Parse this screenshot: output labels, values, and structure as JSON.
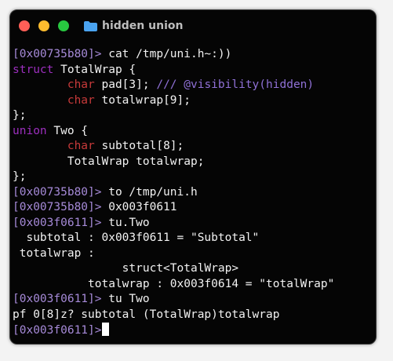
{
  "window": {
    "title": "hidden union",
    "colors": {
      "close": "#ff5f57",
      "minimize": "#febc2e",
      "maximize": "#28c840",
      "folder": "#4aa3f0"
    }
  },
  "terminal": {
    "colors": {
      "text": "#f2f2f2",
      "prompt": "#a68ad8",
      "keyword": "#9d2fbf",
      "type": "#c83a3a",
      "comment": "#8f70d6"
    },
    "lines": [
      [
        {
          "t": "[0x00735b80]> ",
          "c": "prompt"
        },
        {
          "t": "cat /tmp/uni.h~:))",
          "c": "text"
        }
      ],
      [
        {
          "t": "struct",
          "c": "keyword"
        },
        {
          "t": " TotalWrap {",
          "c": "text"
        }
      ],
      [
        {
          "t": "        ",
          "c": "text"
        },
        {
          "t": "char",
          "c": "type"
        },
        {
          "t": " pad[3]; ",
          "c": "text"
        },
        {
          "t": "/// @visibility(hidden)",
          "c": "comment"
        }
      ],
      [
        {
          "t": "        ",
          "c": "text"
        },
        {
          "t": "char",
          "c": "type"
        },
        {
          "t": " totalwrap[9];",
          "c": "text"
        }
      ],
      [
        {
          "t": "};",
          "c": "text"
        }
      ],
      [
        {
          "t": "union",
          "c": "keyword"
        },
        {
          "t": " Two {",
          "c": "text"
        }
      ],
      [
        {
          "t": "        ",
          "c": "text"
        },
        {
          "t": "char",
          "c": "type"
        },
        {
          "t": " subtotal[8];",
          "c": "text"
        }
      ],
      [
        {
          "t": "        TotalWrap totalwrap;",
          "c": "text"
        }
      ],
      [
        {
          "t": "};",
          "c": "text"
        }
      ],
      [
        {
          "t": "[0x00735b80]> ",
          "c": "prompt"
        },
        {
          "t": "to /tmp/uni.h",
          "c": "text"
        }
      ],
      [
        {
          "t": "[0x00735b80]> ",
          "c": "prompt"
        },
        {
          "t": "0x003f0611",
          "c": "text"
        }
      ],
      [
        {
          "t": "[0x003f0611]> ",
          "c": "prompt"
        },
        {
          "t": "tu.Two",
          "c": "text"
        }
      ],
      [
        {
          "t": "  subtotal : 0x003f0611 = \"Subtotal\"",
          "c": "text"
        }
      ],
      [
        {
          "t": " totalwrap :",
          "c": "text"
        }
      ],
      [
        {
          "t": "                struct<TotalWrap>",
          "c": "text"
        }
      ],
      [
        {
          "t": "           totalwrap : 0x003f0614 = \"totalWrap\"",
          "c": "text"
        }
      ],
      [
        {
          "t": "[0x003f0611]> ",
          "c": "prompt"
        },
        {
          "t": "tu Two",
          "c": "text"
        }
      ],
      [
        {
          "t": "pf 0[8]z? subtotal (TotalWrap)totalwrap",
          "c": "text"
        }
      ],
      [
        {
          "t": "[0x003f0611]>",
          "c": "prompt"
        }
      ]
    ]
  }
}
